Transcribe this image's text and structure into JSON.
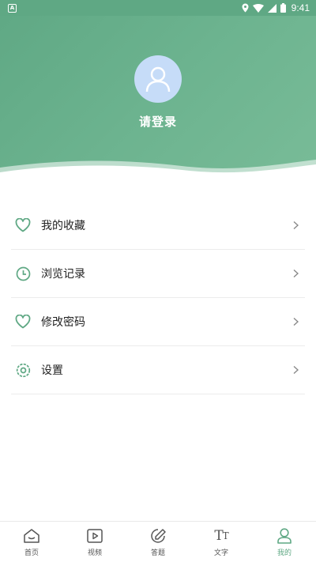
{
  "status_bar": {
    "time": "9:41",
    "app_icon_glyph": "A",
    "icons": [
      "location-icon",
      "wifi-icon",
      "signal-icon",
      "battery-icon"
    ]
  },
  "header": {
    "login_text": "请登录",
    "avatar_icon": "user-icon",
    "gradient_colors": [
      "#5fa884",
      "#79bc98"
    ],
    "avatar_bg": "#c6dcf8"
  },
  "menu": {
    "items": [
      {
        "label": "我的收藏",
        "icon": "heart-icon"
      },
      {
        "label": "浏览记录",
        "icon": "clock-icon"
      },
      {
        "label": "修改密码",
        "icon": "heart-icon"
      },
      {
        "label": "设置",
        "icon": "settings-icon"
      }
    ]
  },
  "bottom_nav": {
    "items": [
      {
        "label": "首页",
        "icon": "home-icon"
      },
      {
        "label": "视频",
        "icon": "video-icon"
      },
      {
        "label": "答题",
        "icon": "edit-icon"
      },
      {
        "label": "文字",
        "icon": "text-icon"
      },
      {
        "label": "我的",
        "icon": "profile-icon",
        "active": true
      }
    ]
  },
  "colors": {
    "accent": "#5fa884",
    "divider": "#ececec"
  }
}
